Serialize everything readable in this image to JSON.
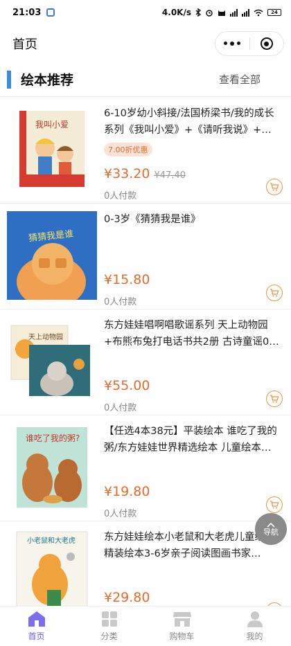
{
  "status_bar": {
    "time": "21:03",
    "speed": "4.0K/s",
    "battery": "24"
  },
  "nav": {
    "title": "首页"
  },
  "section": {
    "title": "绘本推荐",
    "view_all": "查看全部"
  },
  "products": [
    {
      "title": "6-10岁幼小斜接/法国桥梁书/我的成长系列《我叫小爱》+《请听我说》+…",
      "discount": "7.00折优惠",
      "price": "¥33.20",
      "original_price": "¥47.40",
      "sold": "0人付款",
      "cover_text": "我叫小爱"
    },
    {
      "title": "0-3岁《猜猜我是谁》",
      "discount": "",
      "price": "¥15.80",
      "original_price": "",
      "sold": "0人付款",
      "cover_text": "猜猜我是谁"
    },
    {
      "title": "东方娃娃唱啊唱歌谣系列 天上动物园+布熊布兔打电话书共2册 古诗童谣0…",
      "discount": "",
      "price": "¥55.00",
      "original_price": "",
      "sold": "0人付款",
      "cover_text": "天上动物园"
    },
    {
      "title": "【任选4本38元】平装绘本 谁吃了我的粥/东方娃娃世界精选绘本 儿童绘本…",
      "discount": "",
      "price": "¥19.80",
      "original_price": "",
      "sold": "0人付款",
      "cover_text": "谁吃了我的粥?"
    },
    {
      "title": "东方娃娃绘本小老鼠和大老虎儿童绘本精装绘本3-6岁亲子阅读图画书家…",
      "discount": "",
      "price": "¥29.80",
      "original_price": "",
      "sold": "",
      "cover_text": "小老鼠和大老虎"
    }
  ],
  "float_nav": {
    "label": "导航"
  },
  "tabs": [
    {
      "label": "首页",
      "icon": "home-icon",
      "active": true
    },
    {
      "label": "分类",
      "icon": "grid-icon",
      "active": false
    },
    {
      "label": "购物车",
      "icon": "shop-icon",
      "active": false
    },
    {
      "label": "我的",
      "icon": "user-icon",
      "active": false
    }
  ],
  "colors": {
    "accent": "#3d8ad8",
    "price": "#e46b2c",
    "tab_active": "#6c5ce7"
  }
}
